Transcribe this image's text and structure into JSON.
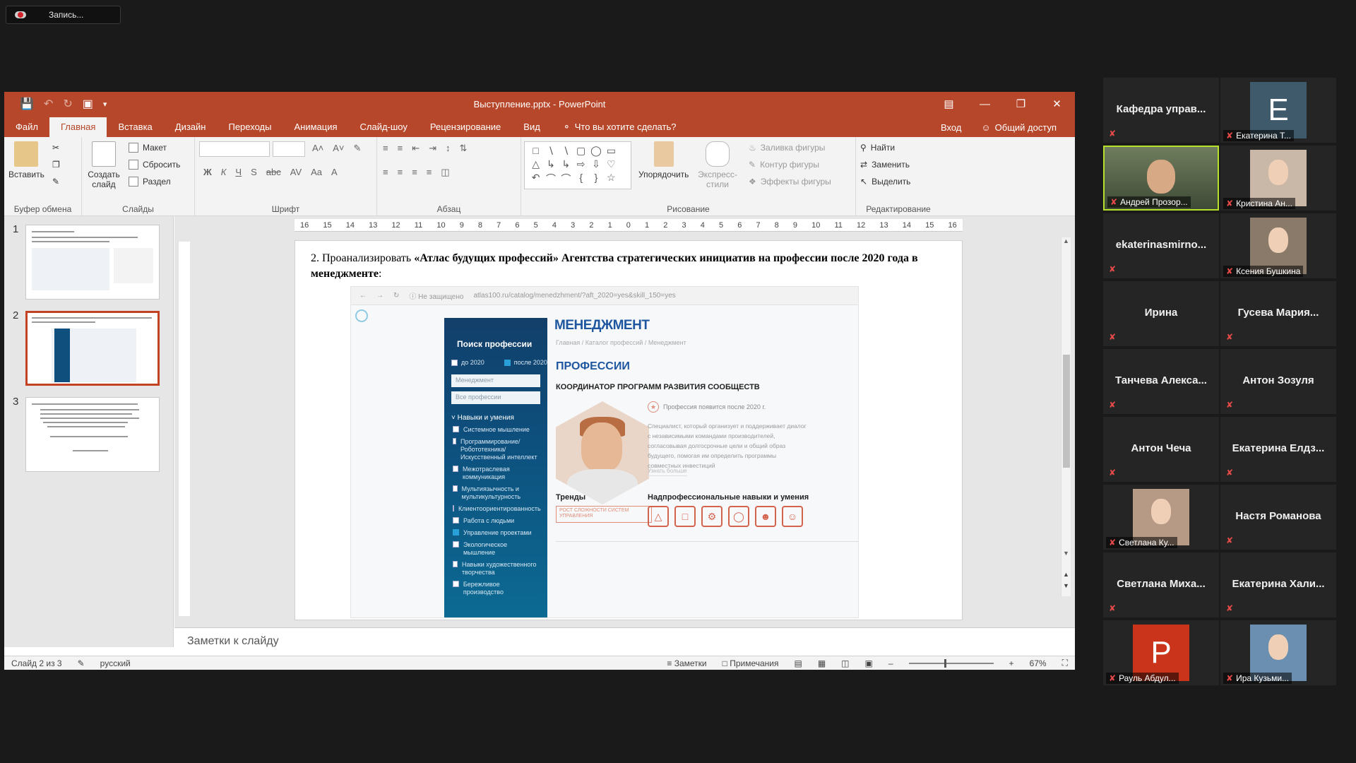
{
  "recording": {
    "label": "Запись..."
  },
  "window": {
    "title": "Выступление.pptx - PowerPoint",
    "tabs": [
      "Файл",
      "Главная",
      "Вставка",
      "Дизайн",
      "Переходы",
      "Анимация",
      "Слайд-шоу",
      "Рецензирование",
      "Вид"
    ],
    "active_tab": "Главная",
    "tell_me": "Что вы хотите сделать?",
    "signin": "Вход",
    "share": "Общий доступ"
  },
  "ribbon": {
    "paste": "Вставить",
    "new_slide": "Создать слайд",
    "layout": "Макет",
    "reset": "Сбросить",
    "section": "Раздел",
    "arrange": "Упорядочить",
    "quick_styles": "Экспресс-стили",
    "shape_fill": "Заливка фигуры",
    "shape_outline": "Контур фигуры",
    "shape_effects": "Эффекты фигуры",
    "find": "Найти",
    "replace": "Заменить",
    "select": "Выделить",
    "group_labels": [
      "Буфер обмена",
      "Слайды",
      "Шрифт",
      "Абзац",
      "Рисование",
      "Редактирование"
    ]
  },
  "thumbnails": {
    "numbers": [
      "1",
      "2",
      "3"
    ],
    "selected": 2
  },
  "ruler": {
    "ticks": [
      "16",
      "15",
      "14",
      "13",
      "12",
      "11",
      "10",
      "9",
      "8",
      "7",
      "6",
      "5",
      "4",
      "3",
      "2",
      "1",
      "0",
      "1",
      "2",
      "3",
      "4",
      "5",
      "6",
      "7",
      "8",
      "9",
      "10",
      "11",
      "12",
      "13",
      "14",
      "15",
      "16"
    ]
  },
  "slide": {
    "text_prefix": "2. Проанализировать ",
    "text_bold": "«Атлас будущих профессий» Агентства стратегических инициатив на профессии после 2020 года в менеджменте",
    "text_suffix": ":",
    "screenshot": {
      "url_warning": "Не защищено",
      "url": "atlas100.ru/catalog/menedzhment/?aft_2020=yes&skill_150=yes",
      "sidebar_title": "Поиск профессии",
      "before_2020": "до 2020",
      "after_2020": "после 2020",
      "select_1": "Менеджмент",
      "select_2": "Все профессии",
      "skills_heading": "Навыки и умения",
      "skills": [
        {
          "label": "Системное мышление",
          "checked": false
        },
        {
          "label": "Программирование/ Робототехника/ Искусственный интеллект",
          "checked": false
        },
        {
          "label": "Межотраслевая коммуникация",
          "checked": false
        },
        {
          "label": "Мультиязычность и мультикультурность",
          "checked": false
        },
        {
          "label": "Клиентоориентированность",
          "checked": false
        },
        {
          "label": "Работа с людьми",
          "checked": false
        },
        {
          "label": "Управление проектами",
          "checked": true
        },
        {
          "label": "Экологическое мышление",
          "checked": false
        },
        {
          "label": "Навыки художественного творчества",
          "checked": false
        },
        {
          "label": "Бережливое производство",
          "checked": false
        }
      ],
      "heading": "МЕНЕДЖМЕНТ",
      "breadcrumb": "Главная  /  Каталог профессий  /  Менеджмент",
      "professions": "ПРОФЕССИИ",
      "job_title": "КООРДИНАТОР ПРОГРАММ РАЗВИТИЯ СООБЩЕСТВ",
      "appears": "Профессия появится после 2020 г.",
      "description": "Специалист, который организует и поддерживает диалог с независимыми командами производителей, согласовывая долгосрочные цели и общий образ будущего, помогая им определить программы совместных инвестиций",
      "more": "Узнать больше",
      "trends": "Тренды",
      "trend_item": "РОСТ СЛОЖНОСТИ СИСТЕМ УПРАВЛЕНИЯ",
      "supra_skills": "Надпрофессиональные навыки и умения"
    }
  },
  "notes": {
    "placeholder": "Заметки к слайду"
  },
  "status": {
    "slide": "Слайд 2 из 3",
    "language": "русский",
    "notes_btn": "Заметки",
    "comments_btn": "Примечания",
    "zoom": "67%"
  },
  "participants": [
    {
      "name": "Кафедра управ...",
      "type": "name"
    },
    {
      "name": "Екатерина Т...",
      "type": "avatar",
      "letter": "E"
    },
    {
      "name": "Андрей Прозор...",
      "type": "video",
      "active": true
    },
    {
      "name": "Кристина Ан...",
      "type": "photo"
    },
    {
      "name": "ekaterinasmirno...",
      "type": "name"
    },
    {
      "name": "Ксения Бушкина",
      "type": "photo"
    },
    {
      "name": "Ирина",
      "type": "name"
    },
    {
      "name": "Гусева Мария...",
      "type": "name"
    },
    {
      "name": "Танчева Алекса...",
      "type": "name"
    },
    {
      "name": "Антон Зозуля",
      "type": "name"
    },
    {
      "name": "Антон Чеча",
      "type": "name"
    },
    {
      "name": "Екатерина Елдз...",
      "type": "name"
    },
    {
      "name": "Светлана Ку...",
      "type": "photo"
    },
    {
      "name": "Настя Романова",
      "type": "name"
    },
    {
      "name": "Светлана Миха...",
      "type": "name"
    },
    {
      "name": "Екатерина Хали...",
      "type": "name"
    },
    {
      "name": "Рауль Абдул...",
      "type": "avatar",
      "letter": "P"
    },
    {
      "name": "Ира Кузьми...",
      "type": "photo"
    }
  ],
  "colors": {
    "ppt_accent": "#b7472a",
    "active_speaker": "#b6e02c",
    "muted": "#e84a4a"
  }
}
